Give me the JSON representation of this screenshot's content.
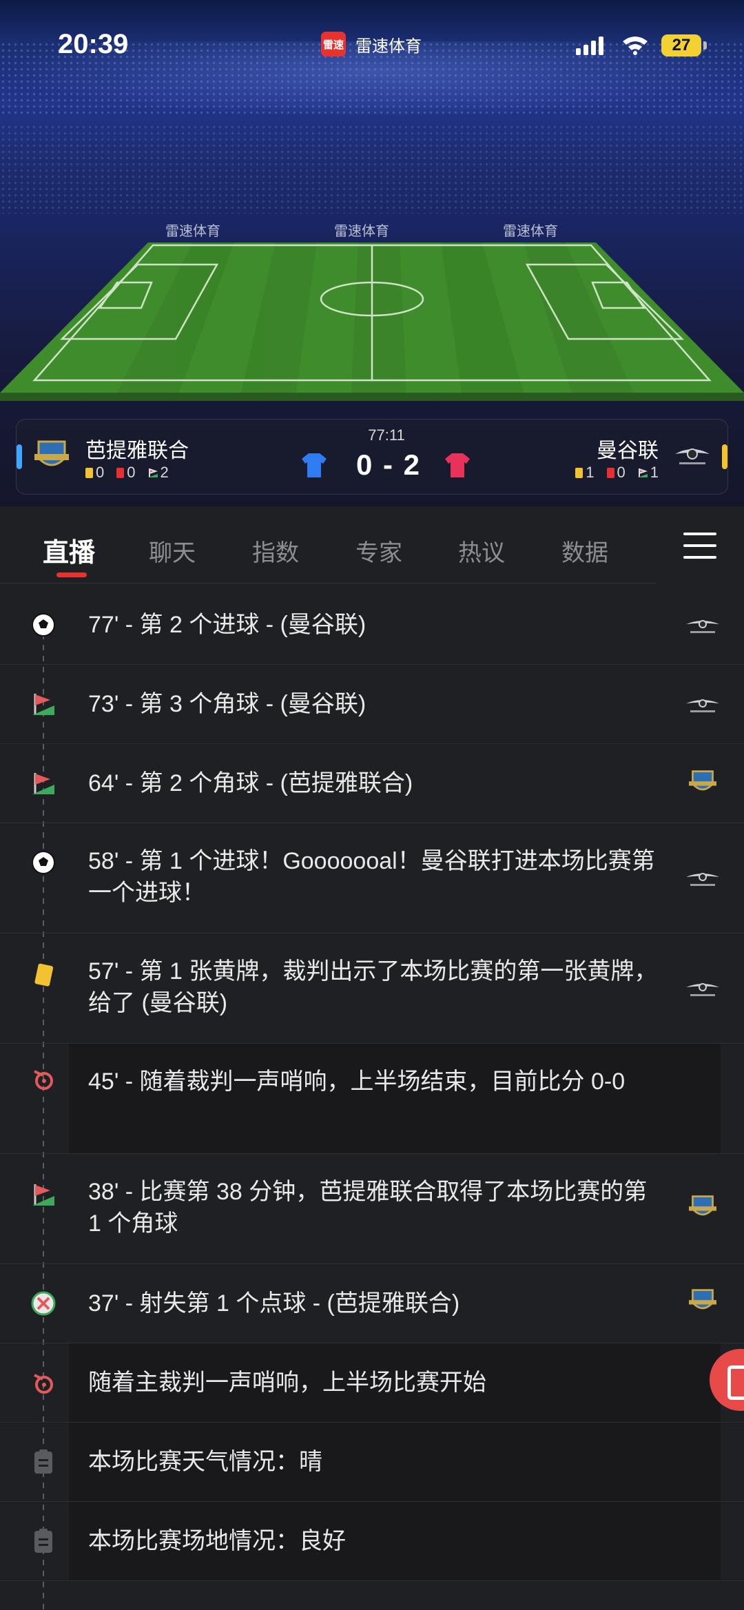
{
  "status": {
    "time": "20:39",
    "battery": "27"
  },
  "app": {
    "name": "雷速体育",
    "logo_text": "雷速"
  },
  "stadium": {
    "board_text": "雷速体育"
  },
  "match": {
    "clock": "77:11",
    "score": "0 - 2",
    "home": {
      "name": "芭提雅联合",
      "yellow": "0",
      "red": "0",
      "corners": "2"
    },
    "away": {
      "name": "曼谷联",
      "yellow": "1",
      "red": "0",
      "corners": "1"
    },
    "colors": {
      "home_kit": "#2f7bf2",
      "away_kit": "#e8325a"
    }
  },
  "tabs": [
    {
      "label": "直播",
      "active": true
    },
    {
      "label": "聊天"
    },
    {
      "label": "指数"
    },
    {
      "label": "专家"
    },
    {
      "label": "热议"
    },
    {
      "label": "数据"
    }
  ],
  "events": [
    {
      "icon": "football-icon",
      "text": "77' - 第 2 个进球 - (曼谷联)",
      "team": "away"
    },
    {
      "icon": "corner-flag-icon",
      "text": "73' - 第 3 个角球 - (曼谷联)",
      "team": "away"
    },
    {
      "icon": "corner-flag-icon",
      "text": "64' - 第 2 个角球 - (芭提雅联合)",
      "team": "home"
    },
    {
      "icon": "football-icon",
      "text": "58' - 第 1 个进球！Gooooooal！曼谷联打进本场比赛第一个进球！",
      "team": "away"
    },
    {
      "icon": "yellow-card-icon",
      "text": "57' - 第 1 张黄牌，裁判出示了本场比赛的第一张黄牌，给了 (曼谷联)",
      "team": "away"
    },
    {
      "icon": "whistle-icon",
      "text": "45' - 随着裁判一声哨响，上半场结束，目前比分 0-0",
      "team": "none"
    },
    {
      "icon": "corner-flag-icon",
      "text": "38' - 比赛第 38 分钟，芭提雅联合取得了本场比赛的第 1 个角球",
      "team": "home"
    },
    {
      "icon": "missed-penalty-icon",
      "text": "37' - 射失第 1 个点球 - (芭提雅联合)",
      "team": "home"
    },
    {
      "icon": "whistle-icon",
      "text": "随着主裁判一声哨响，上半场比赛开始",
      "team": "none"
    },
    {
      "icon": "clipboard-icon",
      "text": "本场比赛天气情况：晴",
      "team": "none"
    },
    {
      "icon": "clipboard-icon",
      "text": "本场比赛场地情况：良好",
      "team": "none"
    }
  ]
}
